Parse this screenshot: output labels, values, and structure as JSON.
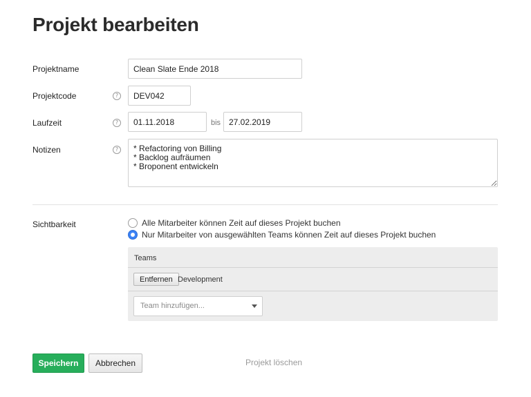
{
  "page": {
    "title": "Projekt bearbeiten"
  },
  "form": {
    "name": {
      "label": "Projektname",
      "value": "Clean Slate Ende 2018"
    },
    "code": {
      "label": "Projektcode",
      "value": "DEV042",
      "help_icon": "?"
    },
    "duration": {
      "label": "Laufzeit",
      "start": "01.11.2018",
      "separator": "bis",
      "end": "27.02.2019",
      "help_icon": "?"
    },
    "notes": {
      "label": "Notizen",
      "value": "* Refactoring von Billing\n* Backlog aufräumen\n* Broponent entwickeln",
      "help_icon": "?"
    }
  },
  "visibility": {
    "label": "Sichtbarkeit",
    "options": [
      {
        "label": "Alle Mitarbeiter können Zeit auf dieses Projekt buchen",
        "checked": false
      },
      {
        "label": "Nur Mitarbeiter von ausgewählten Teams können Zeit auf dieses Projekt buchen",
        "checked": true
      }
    ],
    "teams": {
      "header": "Teams",
      "items": [
        {
          "remove_label": "Entfernen",
          "name": "Development"
        }
      ],
      "add_placeholder": "Team hinzufügen..."
    }
  },
  "actions": {
    "save": "Speichern",
    "cancel": "Abbrechen",
    "delete": "Projekt löschen"
  },
  "colors": {
    "primary": "#27ae5b",
    "radio_selected": "#3b82f6"
  }
}
